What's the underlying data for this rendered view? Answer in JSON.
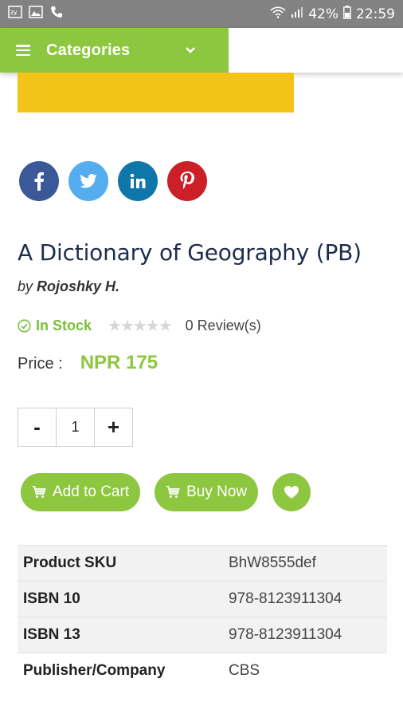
{
  "status_bar": {
    "left_icons": [
      "nepali-keyboard-icon",
      "image-icon",
      "phone-icon"
    ],
    "battery": "42%",
    "time": "22:59"
  },
  "header": {
    "categories_label": "Categories"
  },
  "social": [
    "facebook-icon",
    "twitter-icon",
    "linkedin-icon",
    "pinterest-icon"
  ],
  "product": {
    "title": "A Dictionary of Geography (PB)",
    "by": "by",
    "author": "Rojoshky H.",
    "stock": "In Stock",
    "rating": 0,
    "reviews": "0 Review(s)",
    "price_label": "Price :",
    "price": "NPR 175",
    "quantity": "1",
    "minus": "-",
    "plus": "+"
  },
  "actions": {
    "add_to_cart": "Add to Cart",
    "buy_now": "Buy Now"
  },
  "specs": [
    {
      "key": "Product SKU",
      "value": "BhW8555def"
    },
    {
      "key": "ISBN 10",
      "value": "978-8123911304"
    },
    {
      "key": "ISBN 13",
      "value": "978-8123911304"
    },
    {
      "key": "Publisher/Company",
      "value": "CBS"
    }
  ],
  "colors": {
    "accent": "#8dc63f",
    "title": "#1f2d4d",
    "image_yellow": "#f3c318"
  }
}
